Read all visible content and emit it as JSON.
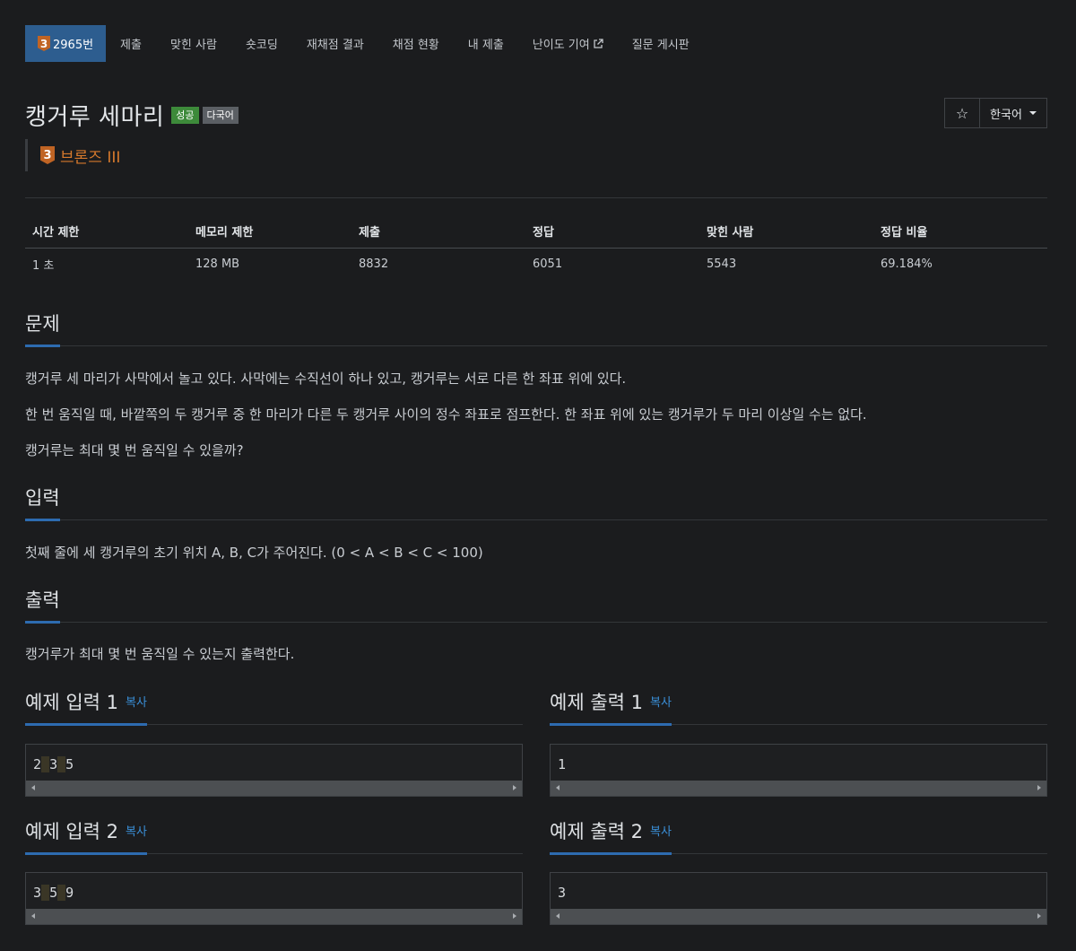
{
  "nav": {
    "problem_tab": {
      "badge": "3",
      "label": "2965번"
    },
    "tabs": [
      "제출",
      "맞힌 사람",
      "숏코딩",
      "재채점 결과",
      "채점 현황",
      "내 제출",
      "난이도 기여",
      "질문 게시판"
    ]
  },
  "problem": {
    "title": "캥거루 세마리",
    "labels": [
      "성공",
      "다국어"
    ],
    "tier_badge": "3",
    "tier": "브론즈 III",
    "language": "한국어",
    "star_icon": "☆"
  },
  "stats": {
    "headers": [
      "시간 제한",
      "메모리 제한",
      "제출",
      "정답",
      "맞힌 사람",
      "정답 비율"
    ],
    "values": [
      "1 초",
      "128 MB",
      "8832",
      "6051",
      "5543",
      "69.184%"
    ]
  },
  "sections": {
    "problem_heading": "문제",
    "problem_lines": [
      "캥거루 세 마리가 사막에서 놀고 있다. 사막에는 수직선이 하나 있고, 캥거루는 서로 다른 한 좌표 위에 있다.",
      "한 번 움직일 때, 바깥쪽의 두 캥거루 중 한 마리가 다른 두 캥거루 사이의 정수 좌표로 점프한다. 한 좌표 위에 있는 캥거루가 두 마리 이상일 수는 없다.",
      "캥거루는 최대 몇 번 움직일 수 있을까?"
    ],
    "input_heading": "입력",
    "input_text": "첫째 줄에 세 캥거루의 초기 위치 A, B, C가 주어진다. (0 < A < B < C < 100)",
    "output_heading": "출력",
    "output_text": "캥거루가 최대 몇 번 움직일 수 있는지 출력한다."
  },
  "samples": {
    "copy_label": "복사",
    "in1": {
      "title": "예제 입력 1",
      "values": [
        "2",
        "3",
        "5"
      ]
    },
    "out1": {
      "title": "예제 출력 1",
      "value": "1"
    },
    "in2": {
      "title": "예제 입력 2",
      "values": [
        "3",
        "5",
        "9"
      ]
    },
    "out2": {
      "title": "예제 출력 2",
      "value": "3"
    }
  }
}
